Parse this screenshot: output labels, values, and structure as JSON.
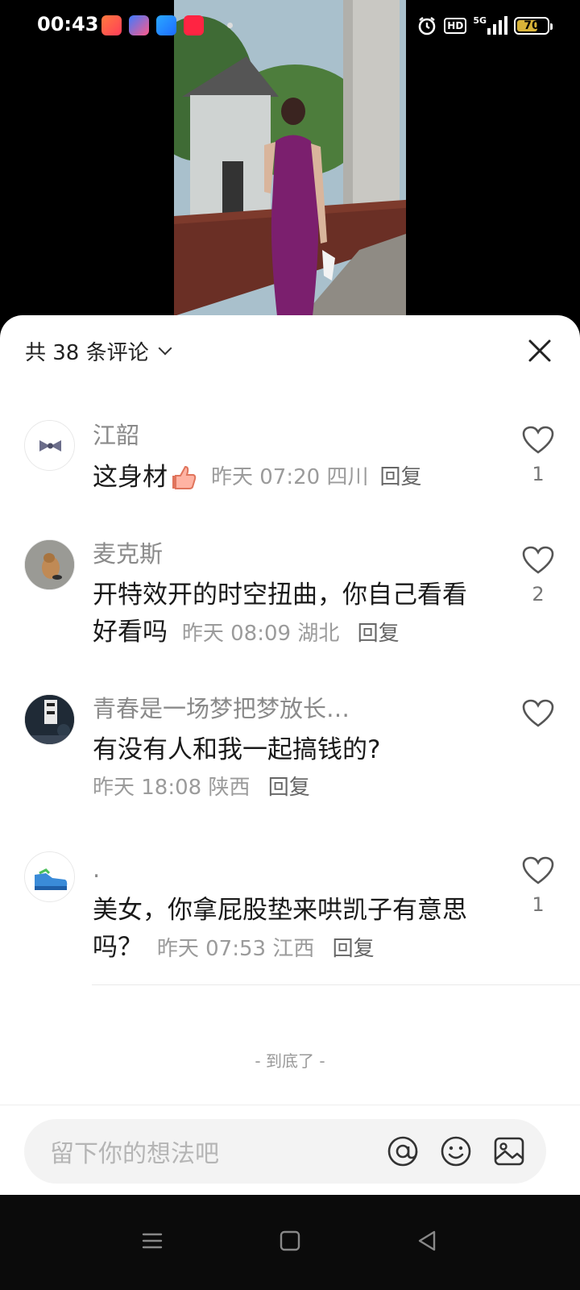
{
  "status_bar": {
    "time": "00:43",
    "hd_label": "HD",
    "network": "5G",
    "battery_level": "70",
    "battery_fraction": 0.7,
    "app_icons": [
      "photos-app-icon",
      "shortcut-app-icon",
      "files-app-icon",
      "xiaohongshu-app-icon"
    ]
  },
  "comments_sheet": {
    "header": {
      "count_label": "共 38 条评论"
    },
    "comments": [
      {
        "author": "江韶",
        "text": "这身材",
        "emoji": "thumbs-up-icon",
        "time": "昨天 07:20",
        "location": "四川",
        "reply_label": "回复",
        "likes": "1"
      },
      {
        "author": "麦克斯",
        "text": "开特效开的时空扭曲，你自己看看好看吗",
        "time": "昨天 08:09",
        "location": "湖北",
        "reply_label": "回复",
        "likes": "2"
      },
      {
        "author": "青春是一场梦把梦放长…",
        "text": "有没有人和我一起搞钱的?",
        "time": "昨天 18:08",
        "location": "陕西",
        "reply_label": "回复",
        "likes": ""
      },
      {
        "author": ".",
        "text": "美女，你拿屁股垫来哄凯子有意思吗？",
        "time": "昨天 07:53",
        "location": "江西",
        "reply_label": "回复",
        "likes": "1"
      }
    ],
    "end_label": "- 到底了 -",
    "input": {
      "placeholder": "留下你的想法吧"
    }
  },
  "colors": {
    "battery": "#d8b338",
    "dress": "#7b1f6e",
    "sheet_bg": "#ffffff"
  }
}
